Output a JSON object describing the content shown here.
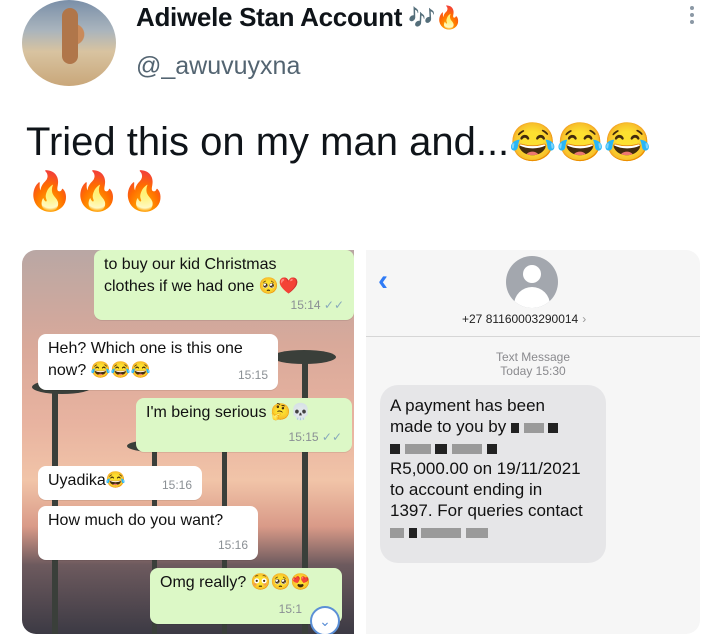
{
  "tweet": {
    "display_name": "Adiwele Stan Account",
    "name_emojis": "🎶🔥",
    "handle": "@_awuvuyxna",
    "text": "Tried this on my man and...",
    "laugh_emojis": "😂😂😂",
    "fire_emojis": "🔥🔥🔥",
    "more_icon": "more-options-icon"
  },
  "whatsapp": {
    "messages": [
      {
        "direction": "out",
        "text": "to buy our kid Christmas clothes if we had one 🥺❤️",
        "time": "15:14",
        "ticks": "✓✓"
      },
      {
        "direction": "in",
        "text": "Heh? Which one is this one now? 😂😂😂",
        "time": "15:15"
      },
      {
        "direction": "out",
        "text": "I'm being serious 🤔💀",
        "time": "15:15",
        "ticks": "✓✓"
      },
      {
        "direction": "in",
        "text": "Uyadika😂",
        "time": "15:16"
      },
      {
        "direction": "in",
        "text": "How much do you want?",
        "time": "15:16"
      },
      {
        "direction": "out",
        "text": "Omg really? 😳🥺😍",
        "time": "15:1"
      }
    ],
    "scroll_icon": "chevron-down-icon"
  },
  "sms": {
    "back_icon": "back-chevron-icon",
    "contact_icon": "contact-avatar-icon",
    "sender_number": "+27 81160003290014",
    "chevron": "›",
    "label": "Text Message",
    "timestamp": "Today 15:30",
    "message_line1": "A payment has been",
    "message_line2": "made to you by",
    "message_line3": "R5,000.00 on 19/11/2021",
    "message_line4": "to account ending in",
    "message_line5": "1397. For queries contact"
  }
}
